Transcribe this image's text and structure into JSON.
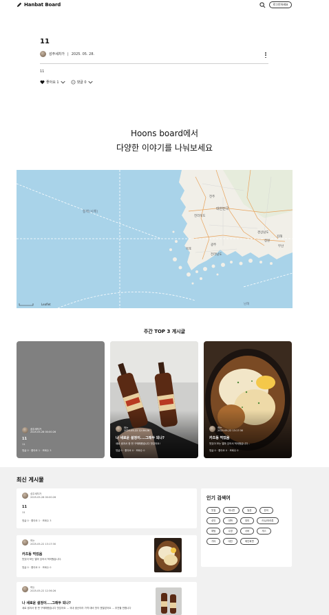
{
  "header": {
    "logo_text": "Hanbat Board",
    "login_label": "로그인하세요"
  },
  "post": {
    "title": "11",
    "author": "성주세차가",
    "date": "2025. 05. 28.",
    "body": "11",
    "like_label": "좋아요 1",
    "comment_label": "댓글 0"
  },
  "hero": {
    "line1": "Hoons board에서",
    "line2": "다양한 이야기를 나눠보세요"
  },
  "map": {
    "labels": [
      "황해(서해)",
      "대한민국",
      "전라북도",
      "경상남도",
      "광주",
      "전라남도",
      "목포",
      "부산",
      "김해",
      "창원",
      "남해",
      "전주",
      "Leaflet"
    ]
  },
  "top3": {
    "title": "주간 TOP 3 게시글",
    "cards": [
      {
        "author": "성주세차가",
        "date": "2025-05-28 00:00:26",
        "title": "11",
        "excerpt": "11",
        "meta": "댓글 0 · 좋아요 1 · 조회수 3"
      },
      {
        "author": "하는",
        "date": "2025-05-22 12:36:26",
        "title": "나 새로운 설정이....그래두 되나?",
        "excerpt": "새로 생겨서 한 번 구매해봤습니다 맛있어요!",
        "meta": "댓글 0 · 좋아요 0 · 조회수 0"
      },
      {
        "author": "하는",
        "date": "2025-05-22 13:17:30",
        "title": "카츠동 먹었음",
        "excerpt": "맛있어 보는 얼마 있어서 먹어봤습니다 ..",
        "meta": "댓글 0 · 좋아요 0 · 조회수 0"
      }
    ]
  },
  "latest": {
    "title": "최신 게시물",
    "items": [
      {
        "author": "성주세차가",
        "date": "2025-05-28 00:00:26",
        "title": "11",
        "excerpt": "11",
        "meta": "댓글 0 · 좋아요 1 · 조회수 3"
      },
      {
        "author": "하는",
        "date": "2025-05-22 13:17:30",
        "title": "카츠동 먹었음",
        "excerpt": "맛있어 보는 얼마 있어서 먹어봤습니다.",
        "meta": "댓글 0 · 좋아요 0 · 조회수 0"
      },
      {
        "author": "하는",
        "date": "2025-05-22 12:36:26",
        "title": "나 새로운 설정이....그래두 되나?",
        "excerpt": "새로 생겨서 한 번 구매해봤습니다 맛있어요 ... 국내 생산이라 가격 대비 맛이 괜찮았어요 ... 추천할 만합니다",
        "meta": ""
      }
    ]
  },
  "popular_tags": {
    "title": "인기 검색어",
    "tags": [
      "맛집",
      "게시판",
      "일본",
      "한국",
      "성인",
      "대학",
      "취미",
      "러닝/마라톤",
      "채팅",
      "수영",
      "서버",
      "게스",
      "기타",
      "대전",
      "메인화면"
    ]
  },
  "colors": {
    "card_grey": "#808080",
    "section_bg": "#f1f1f1",
    "sea": "#a9d3e9"
  }
}
